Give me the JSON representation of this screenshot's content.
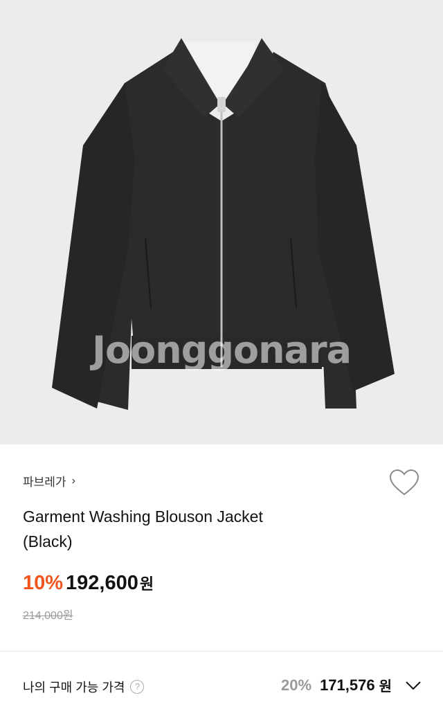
{
  "product_image": {
    "watermark": "Joonggonara",
    "background_color": "#ececec",
    "garment_color": "#2b2b2d"
  },
  "product": {
    "brand": "파브레가",
    "title_line1": "Garment Washing Blouson Jacket",
    "title_line2": "(Black)",
    "discount_percent": "10%",
    "price": "192,600",
    "currency_suffix": "원",
    "original_price": "214,000원"
  },
  "purchase": {
    "label": "나의 구매 가능 가격",
    "help_icon": "?",
    "discount_percent": "20%",
    "price": "171,576",
    "currency_suffix": "원"
  },
  "colors": {
    "accent_discount": "#f2541e",
    "muted": "#9a9a9a"
  },
  "icons": {
    "wishlist": "heart-outline-icon",
    "brand_chevron": "chevron-right-icon",
    "expand": "chevron-down-icon",
    "help": "question-circle-icon"
  }
}
